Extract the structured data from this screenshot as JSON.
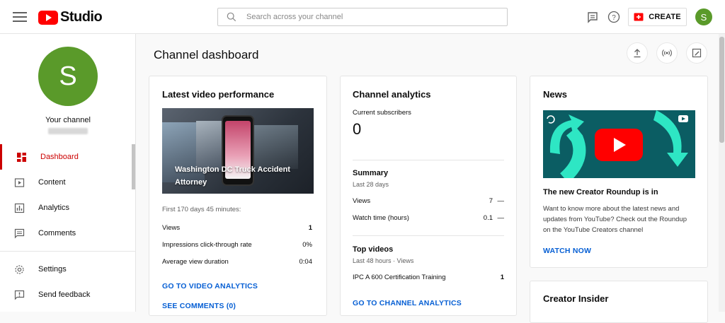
{
  "header": {
    "logo_text": "Studio",
    "search_placeholder": "Search across your channel",
    "create_label": "CREATE",
    "avatar_letter": "S"
  },
  "sidebar": {
    "avatar_letter": "S",
    "your_channel": "Your channel",
    "items": [
      {
        "label": "Dashboard",
        "icon": "dashboard-icon",
        "active": true
      },
      {
        "label": "Content",
        "icon": "content-icon"
      },
      {
        "label": "Analytics",
        "icon": "analytics-icon"
      },
      {
        "label": "Comments",
        "icon": "comments-icon"
      },
      {
        "label": "Settings",
        "icon": "gear-icon"
      },
      {
        "label": "Send feedback",
        "icon": "feedback-icon"
      }
    ]
  },
  "page": {
    "title": "Channel dashboard"
  },
  "latest_video": {
    "title": "Latest video performance",
    "video_title": "Washington DC Truck Accident Attorney",
    "period": "First 170 days 45 minutes:",
    "stats": [
      {
        "label": "Views",
        "value": "1"
      },
      {
        "label": "Impressions click-through rate",
        "value": "0%"
      },
      {
        "label": "Average view duration",
        "value": "0:04"
      }
    ],
    "link_analytics": "GO TO VIDEO ANALYTICS",
    "link_comments": "SEE COMMENTS (0)"
  },
  "channel_analytics": {
    "title": "Channel analytics",
    "subs_label": "Current subscribers",
    "subs_value": "0",
    "summary_title": "Summary",
    "summary_period": "Last 28 days",
    "summary_stats": [
      {
        "label": "Views",
        "value": "7",
        "trend": "—"
      },
      {
        "label": "Watch time (hours)",
        "value": "0.1",
        "trend": "—"
      }
    ],
    "top_title": "Top videos",
    "top_period": "Last 48 hours · Views",
    "top_videos": [
      {
        "label": "IPC A 600 Certification Training",
        "value": "1"
      }
    ],
    "link": "GO TO CHANNEL ANALYTICS"
  },
  "news": {
    "title": "News",
    "headline": "The new Creator Roundup is in",
    "body": "Want to know more about the latest news and updates from YouTube? Check out the Roundup on the YouTube Creators channel",
    "link": "WATCH NOW"
  },
  "creator_insider": {
    "title": "Creator Insider"
  },
  "colors": {
    "accent": "#cc0000",
    "link": "#065fd4",
    "avatar": "#5a9a2a"
  }
}
